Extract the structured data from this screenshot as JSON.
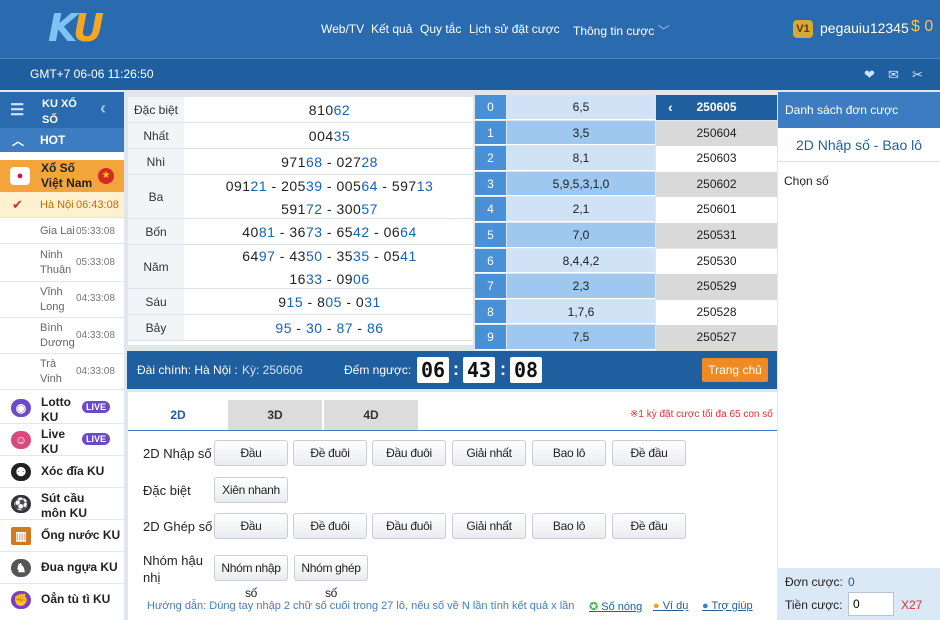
{
  "brand": {
    "logo_k": "K",
    "logo_u": "U"
  },
  "nav": {
    "items": [
      "Web/TV",
      "Kết quả",
      "Quy tắc",
      "Lịch sử đặt cược",
      "Thông tin cược"
    ]
  },
  "user": {
    "level": "V1",
    "name": "pegauiu12345",
    "balance": "$ 0"
  },
  "clock": "GMT+7 06-06 11:26:50",
  "sidebar": {
    "title": "KU XỔ SỐ",
    "hot": "HOT",
    "category": "Xổ Số Việt Nam",
    "regions": [
      {
        "name": "Hà Nội",
        "time": "06:43:08"
      },
      {
        "name": "Gia Lai",
        "time": "05:33:08"
      },
      {
        "name": "Ninh Thuận",
        "time": "05:33:08"
      },
      {
        "name": "Vĩnh Long",
        "time": "04:33:08"
      },
      {
        "name": "Bình Dương",
        "time": "04:33:08"
      },
      {
        "name": "Trà Vinh",
        "time": "04:33:08"
      }
    ],
    "games": [
      {
        "name": "Lotto KU",
        "live": "LIVE"
      },
      {
        "name": "Live KU",
        "live": "LIVE"
      },
      {
        "name": "Xóc đĩa KU"
      },
      {
        "name": "Sút cầu môn KU"
      },
      {
        "name": "Ống nước KU"
      },
      {
        "name": "Đua ngựa KU"
      },
      {
        "name": "Oẳn tù tì KU"
      }
    ]
  },
  "results": [
    {
      "label": "Đặc biệt",
      "lines": [
        [
          [
            "810",
            "62"
          ]
        ]
      ]
    },
    {
      "label": "Nhất",
      "lines": [
        [
          [
            "004",
            "35"
          ]
        ]
      ]
    },
    {
      "label": "Nhì",
      "lines": [
        [
          [
            "971",
            "68"
          ],
          [
            "027",
            "28"
          ]
        ]
      ]
    },
    {
      "label": "Ba",
      "lines": [
        [
          [
            "091",
            "21"
          ],
          [
            "205",
            "39"
          ],
          [
            "005",
            "64"
          ],
          [
            "597",
            "13"
          ]
        ],
        [
          [
            "591",
            "72"
          ],
          [
            "300",
            "57"
          ]
        ]
      ]
    },
    {
      "label": "Bốn",
      "lines": [
        [
          [
            "40",
            "81"
          ],
          [
            "36",
            "73"
          ],
          [
            "65",
            "42"
          ],
          [
            "06",
            "64"
          ]
        ]
      ]
    },
    {
      "label": "Năm",
      "lines": [
        [
          [
            "64",
            "97"
          ],
          [
            "43",
            "50"
          ],
          [
            "35",
            "35"
          ],
          [
            "05",
            "41"
          ]
        ],
        [
          [
            "16",
            "33"
          ],
          [
            "09",
            "06"
          ]
        ]
      ]
    },
    {
      "label": "Sáu",
      "lines": [
        [
          [
            "9",
            "15"
          ],
          [
            "8",
            "05"
          ],
          [
            "0",
            "31"
          ]
        ]
      ]
    },
    {
      "label": "Bảy",
      "lines": [
        [
          [
            "",
            "95"
          ],
          [
            "",
            "30"
          ],
          [
            "",
            "87"
          ],
          [
            "",
            "86"
          ]
        ]
      ]
    }
  ],
  "digits": [
    {
      "d": "0",
      "v": "6,5"
    },
    {
      "d": "1",
      "v": "3,5"
    },
    {
      "d": "2",
      "v": "8,1"
    },
    {
      "d": "3",
      "v": "5,9,5,3,1,0"
    },
    {
      "d": "4",
      "v": "2,1"
    },
    {
      "d": "5",
      "v": "7,0"
    },
    {
      "d": "6",
      "v": "8,4,4,2"
    },
    {
      "d": "7",
      "v": "2,3"
    },
    {
      "d": "8",
      "v": "1,7,6"
    },
    {
      "d": "9",
      "v": "7,5"
    }
  ],
  "periods": [
    "250605",
    "250604",
    "250603",
    "250602",
    "250601",
    "250531",
    "250530",
    "250529",
    "250528",
    "250527"
  ],
  "info": {
    "station": "Đài chính: Hà Nội :",
    "period": "Kỳ: 250606",
    "countdown_label": "Đếm ngược:",
    "h": "06",
    "m": "43",
    "s": "08",
    "home_btn": "Trang chủ"
  },
  "tabs": [
    "2D",
    "3D",
    "4D"
  ],
  "note": "※1 kỳ đặt cược tối đa 65 con số",
  "rows": {
    "r1": "2D Nhập số",
    "r2": "Đặc biệt",
    "r3": "2D Ghép số",
    "r4": "Nhóm hậu nhị",
    "r1_btns": [
      "Đầu",
      "Đề đuôi",
      "Đầu đuôi",
      "Giải nhất",
      "Bao lô",
      "Đề đầu"
    ],
    "r2_btns": [
      "Xiên nhanh"
    ],
    "r3_btns": [
      "Đầu",
      "Đề đuôi",
      "Đầu đuôi",
      "Giải nhất",
      "Bao lô",
      "Đề đầu"
    ],
    "r4_btns": [
      "Nhóm nhập số",
      "Nhóm ghép số"
    ]
  },
  "guide": "Hướng dẫn: Dùng tay nhập 2 chữ số cuối trong 27 lô, nếu số về N lần tính kết quả x lần",
  "links": [
    "Số nóng",
    "Ví dụ",
    "Trợ giúp"
  ],
  "right": {
    "title": "Danh sách đơn cược",
    "subtitle": "2D Nhập số - Bao lô",
    "chon": "Chọn số",
    "don_label": "Đơn cược:",
    "don_val": "0",
    "tien_label": "Tiền cược:",
    "tien_val": "0",
    "mult": "X27"
  },
  "colors": {
    "accent": "#2a6bb0",
    "orange": "#f08a24",
    "active_btn": "#f4b3b3"
  }
}
